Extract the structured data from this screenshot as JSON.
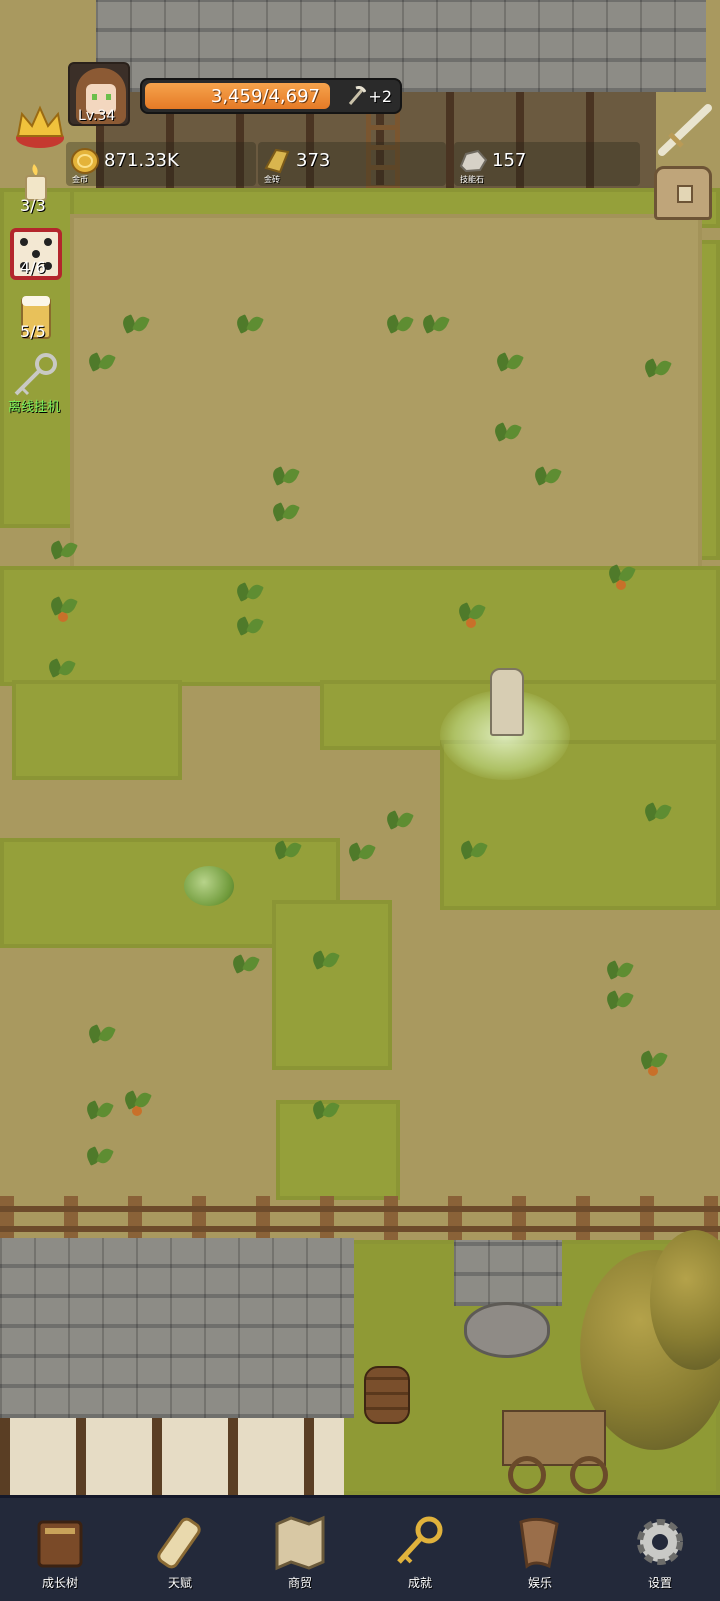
{
  "player": {
    "level": "Lv.34",
    "xp_text": "3,459/4,697",
    "xp_fraction": 0.736,
    "xp_bonus": "+2"
  },
  "resources": [
    {
      "value": "871.33K",
      "label": "金币",
      "icon": "gold-coin-icon"
    },
    {
      "value": "373",
      "label": "金砖",
      "icon": "gold-bar-icon"
    },
    {
      "value": "157",
      "label": "技能石",
      "icon": "skill-stone-icon"
    }
  ],
  "side_buttons": {
    "crown": {
      "icon": "crown-icon"
    },
    "candle": {
      "count": "3/3",
      "icon": "candle-icon"
    },
    "dice": {
      "count": "4/6",
      "icon": "dice-icon"
    },
    "beer": {
      "count": "5/5",
      "icon": "beer-icon"
    },
    "idle": {
      "label": "离线挂机",
      "icon": "key-icon"
    }
  },
  "right_buttons": {
    "sword": {
      "icon": "sword-icon"
    },
    "chest": {
      "icon": "treasure-chest-icon"
    }
  },
  "nav": [
    {
      "label": "成长树",
      "icon": "book-icon"
    },
    {
      "label": "天赋",
      "icon": "scroll-icon"
    },
    {
      "label": "商贸",
      "icon": "map-icon"
    },
    {
      "label": "成就",
      "icon": "golden-key-icon"
    },
    {
      "label": "娱乐",
      "icon": "parchment-icon"
    },
    {
      "label": "设置",
      "icon": "gear-icon"
    }
  ],
  "colors": {
    "grass": "#95a03a",
    "dirt": "#ad9d63",
    "nav_bg": "#23293a",
    "xp_fill": "#e57a26",
    "idle_label": "#7bf05b"
  }
}
